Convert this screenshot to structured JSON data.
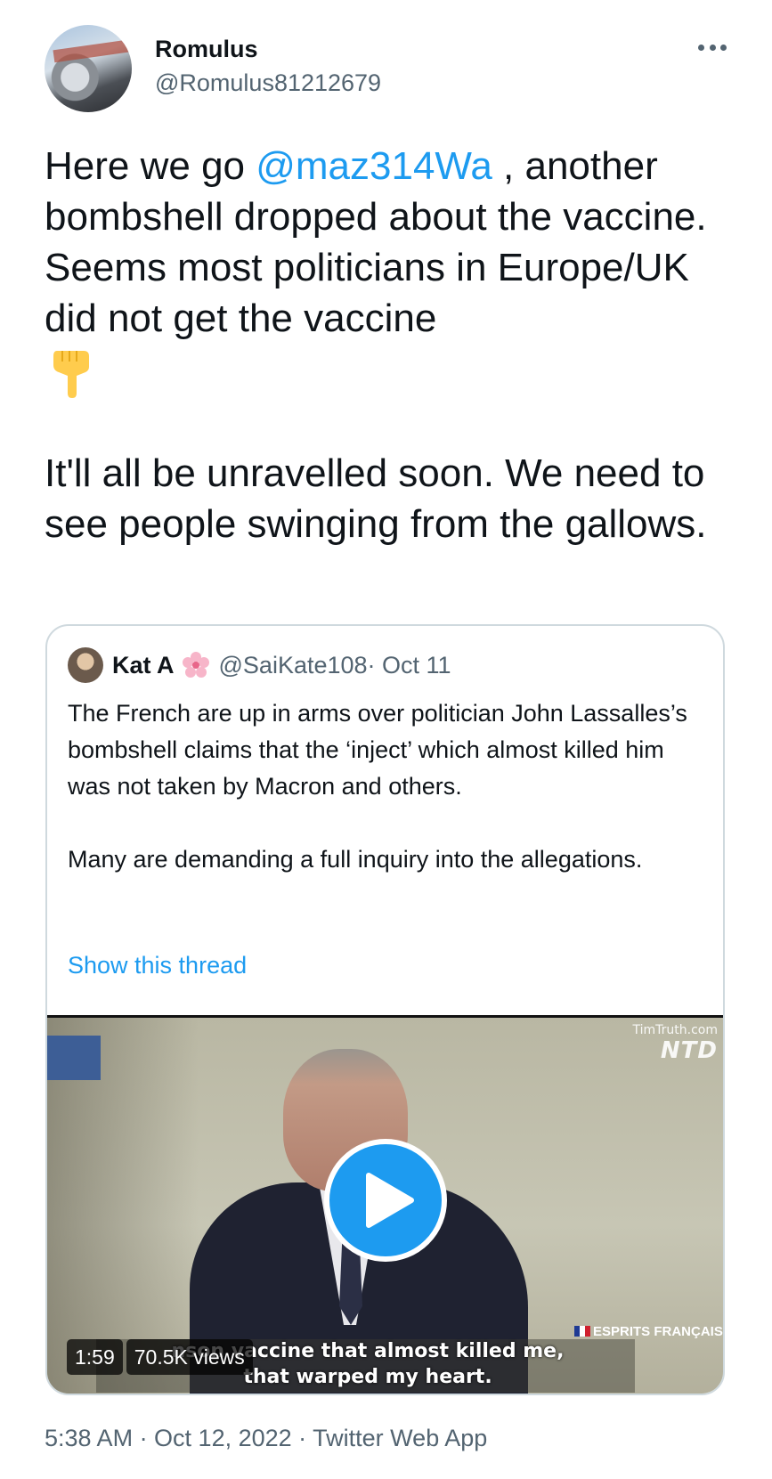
{
  "tweet": {
    "author": {
      "name": "Romulus",
      "handle": "@Romulus81212679"
    },
    "text_before_mention": "Here we go ",
    "mention": "@maz314Wa",
    "text_after_mention": " , another bombshell dropped about the vaccine. Seems most politicians in Europe/UK did not get the vaccine",
    "emoji": "backhand-index-pointing-down",
    "paragraph2": "It'll all be unravelled soon. We need to see people swinging from the gallows.",
    "footer": "5:38 AM · Oct 12, 2022 · Twitter Web App"
  },
  "quoted_tweet": {
    "author": {
      "name": "Kat A",
      "emoji": "cherry-blossom",
      "handle": "@SaiKate108",
      "date": " · Oct 11"
    },
    "paragraph1": "The French are up in arms over politician John Lassalles’s  bombshell claims that the ‘inject’ which almost killed him was not taken by Macron and others.",
    "paragraph2": "Many are demanding a full inquiry into the allegations.",
    "show_thread": "Show this thread",
    "video": {
      "duration": "1:59",
      "views": "70.5K views",
      "watermark_top": "TimTruth.com",
      "watermark_logo": "NTD",
      "channel_mark": "ESPRITS FRANÇAIS",
      "subtitle_line1": "nson vaccine that almost killed me,",
      "subtitle_line2": "that warped my heart."
    }
  },
  "colors": {
    "link": "#1d9bf0",
    "secondary_text": "#536471",
    "border": "#cfd9de"
  }
}
